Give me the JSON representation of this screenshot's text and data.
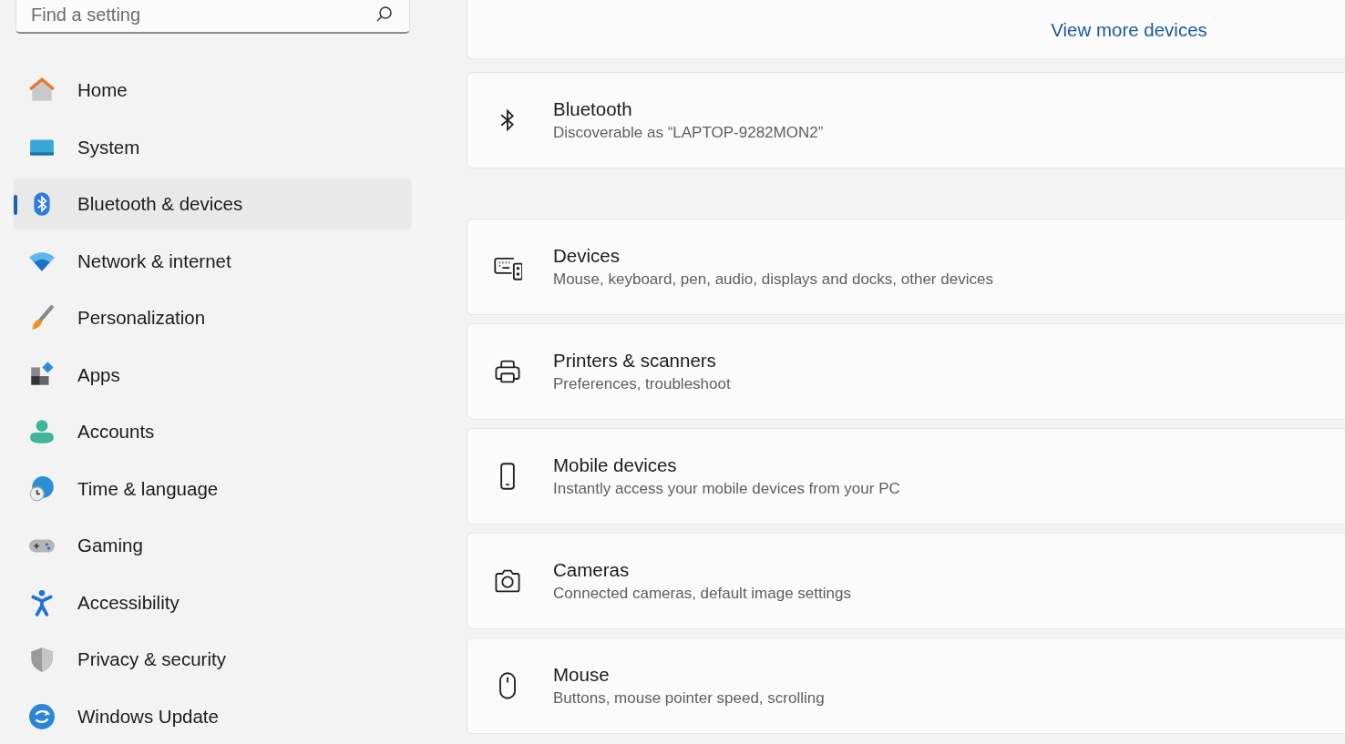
{
  "search": {
    "placeholder": "Find a setting"
  },
  "nav": [
    {
      "label": "Home",
      "selected": false
    },
    {
      "label": "System",
      "selected": false
    },
    {
      "label": "Bluetooth & devices",
      "selected": true
    },
    {
      "label": "Network & internet",
      "selected": false
    },
    {
      "label": "Personalization",
      "selected": false
    },
    {
      "label": "Apps",
      "selected": false
    },
    {
      "label": "Accounts",
      "selected": false
    },
    {
      "label": "Time & language",
      "selected": false
    },
    {
      "label": "Gaming",
      "selected": false
    },
    {
      "label": "Accessibility",
      "selected": false
    },
    {
      "label": "Privacy & security",
      "selected": false
    },
    {
      "label": "Windows Update",
      "selected": false
    }
  ],
  "view_more": "View more devices",
  "bluetooth": {
    "title": "Bluetooth",
    "subtitle": "Discoverable as “LAPTOP-9282MON2”"
  },
  "settings": [
    {
      "title": "Devices",
      "subtitle": "Mouse, keyboard, pen, audio, displays and docks, other devices"
    },
    {
      "title": "Printers & scanners",
      "subtitle": "Preferences, troubleshoot"
    },
    {
      "title": "Mobile devices",
      "subtitle": "Instantly access your mobile devices from your PC"
    },
    {
      "title": "Cameras",
      "subtitle": "Connected cameras, default image settings"
    },
    {
      "title": "Mouse",
      "subtitle": "Buttons, mouse pointer speed, scrolling"
    }
  ]
}
